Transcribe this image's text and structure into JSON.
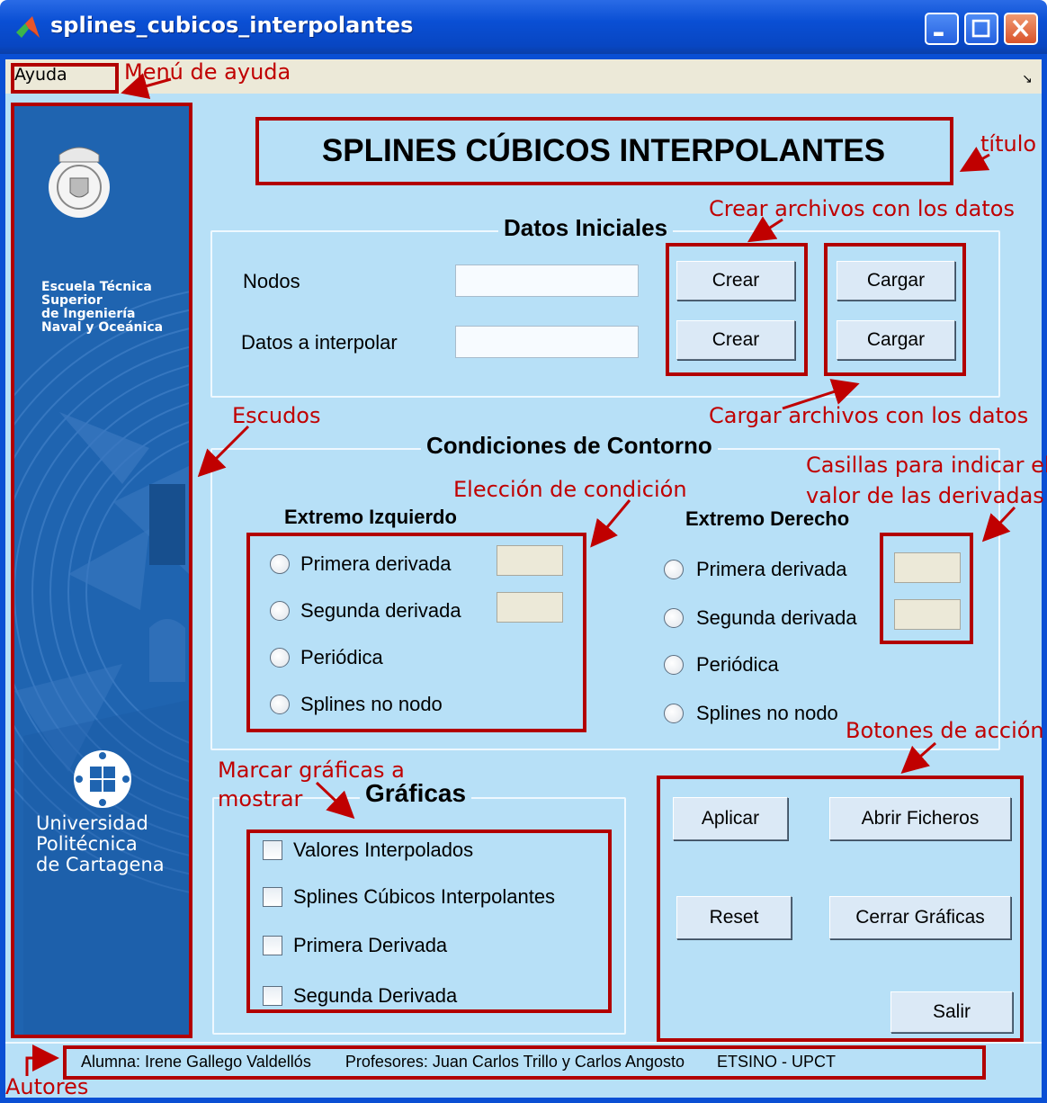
{
  "window": {
    "title": "splines_cubicos_interpolantes",
    "colors": {
      "titlebar": "#0a4fd4",
      "client": "#b7e0f7",
      "annotation": "#c00000"
    }
  },
  "menu": {
    "items": [
      "Ayuda"
    ],
    "corner_glyph": "↘"
  },
  "banner": {
    "school": [
      "Escuela Técnica",
      "Superior",
      "de Ingeniería",
      "Naval y Oceánica"
    ],
    "university": [
      "Universidad",
      "Politécnica",
      "de Cartagena"
    ]
  },
  "title": "SPLINES CÚBICOS INTERPOLANTES",
  "datos_iniciales": {
    "heading": "Datos Iniciales",
    "rows": [
      {
        "label": "Nodos",
        "value": "",
        "crear": "Crear",
        "cargar": "Cargar"
      },
      {
        "label": "Datos a interpolar",
        "value": "",
        "crear": "Crear",
        "cargar": "Cargar"
      }
    ]
  },
  "condiciones": {
    "heading": "Condiciones de Contorno",
    "izquierdo": {
      "heading": "Extremo Izquierdo",
      "options": [
        "Primera derivada",
        "Segunda derivada",
        "Periódica",
        "Splines no nodo"
      ]
    },
    "derecho": {
      "heading": "Extremo Derecho",
      "options": [
        "Primera derivada",
        "Segunda derivada",
        "Periódica",
        "Splines no nodo"
      ]
    }
  },
  "graficas": {
    "heading": "Gráficas",
    "options": [
      "Valores Interpolados",
      "Splines Cúbicos Interpolantes",
      "Primera Derivada",
      "Segunda Derivada"
    ]
  },
  "actions": {
    "aplicar": "Aplicar",
    "abrir": "Abrir Ficheros",
    "reset": "Reset",
    "cerrar": "Cerrar Gráficas",
    "salir": "Salir"
  },
  "footer": {
    "alumna": "Alumna: Irene Gallego Valdellós",
    "profesores": "Profesores: Juan Carlos Trillo y Carlos Angosto",
    "escuela": "ETSINO - UPCT"
  },
  "annotations": {
    "menu": "Menú de ayuda",
    "titulo": "título",
    "crear": "Crear archivos con los datos",
    "cargar": "Cargar archivos con los datos",
    "escudos": "Escudos",
    "eleccion": "Elección de condición",
    "casillas": [
      "Casillas para indicar el",
      "valor de las derivadas"
    ],
    "marcar": [
      "Marcar gráficas a",
      "mostrar"
    ],
    "botones": "Botones de acción",
    "autores": "Autores"
  }
}
